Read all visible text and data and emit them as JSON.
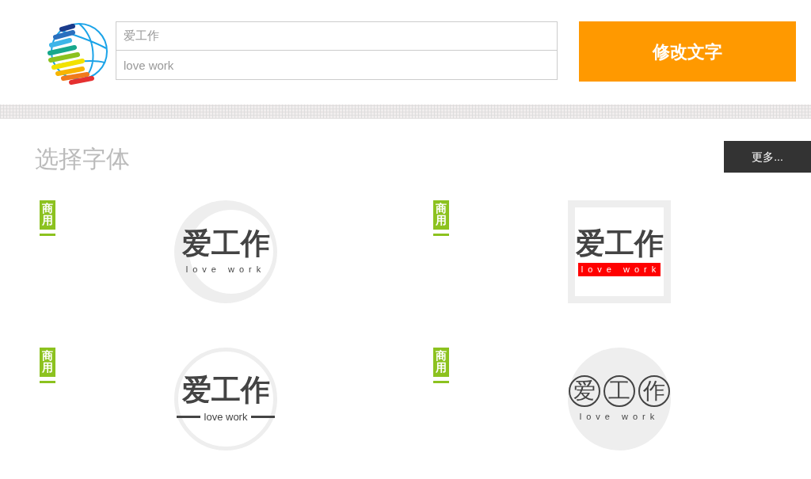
{
  "header": {
    "fields": [
      {
        "value": "爱工作"
      },
      {
        "value": "love work"
      }
    ],
    "apply_button": "修改文字"
  },
  "section": {
    "title": "选择字体",
    "more_button": "更多..."
  },
  "samples": [
    {
      "kind": "crescent",
      "tag": "商用",
      "title": "爱工作",
      "subtitle": "love work"
    },
    {
      "kind": "frame",
      "tag": "商用",
      "title": "爱工作",
      "subtitle": "love work"
    },
    {
      "kind": "ring",
      "tag": "商用",
      "title": "爱工作",
      "subtitle": "love work"
    },
    {
      "kind": "circled",
      "tag": "商用",
      "characters": [
        "爱",
        "工",
        "作"
      ],
      "subtitle": "love work"
    }
  ]
}
